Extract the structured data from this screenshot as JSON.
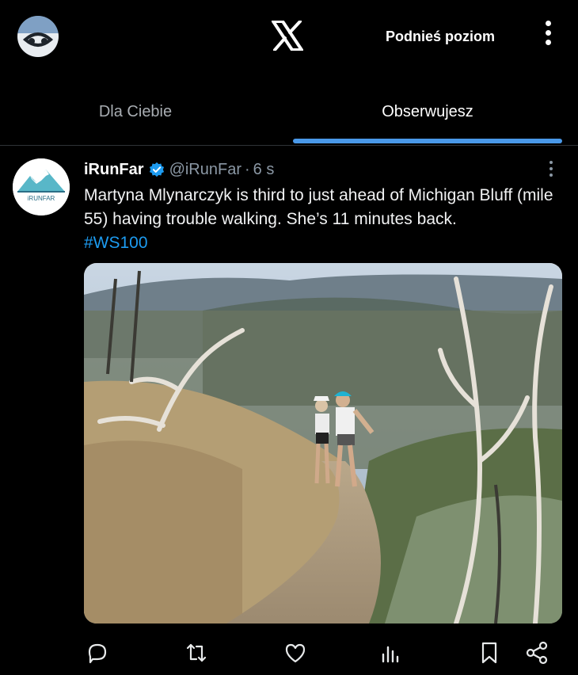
{
  "header": {
    "upgrade_label": "Podnieś poziom",
    "logo_icon": "x-logo-icon"
  },
  "tabs": [
    {
      "label": "Dla Ciebie",
      "active": false
    },
    {
      "label": "Obserwujesz",
      "active": true
    }
  ],
  "tweet": {
    "author_name": "iRunFar",
    "verified": true,
    "handle": "@iRunFar",
    "separator": "·",
    "time": "6 s",
    "text": "Martyna Mlynarczyk is third to just ahead of Michigan Bluff (mile 55) having trouble walking. She’s 11 minutes back.",
    "hashtag": "#WS100",
    "avatar_text": "iRUNFAR",
    "media_icon": "trail-photo"
  },
  "actions": [
    "reply-icon",
    "retweet-icon",
    "like-icon",
    "views-icon",
    "bookmark-icon",
    "share-icon"
  ],
  "colors": {
    "accent": "#1d9bf0",
    "tab_indicator": "#4a99e9",
    "muted": "#8b98a5"
  }
}
